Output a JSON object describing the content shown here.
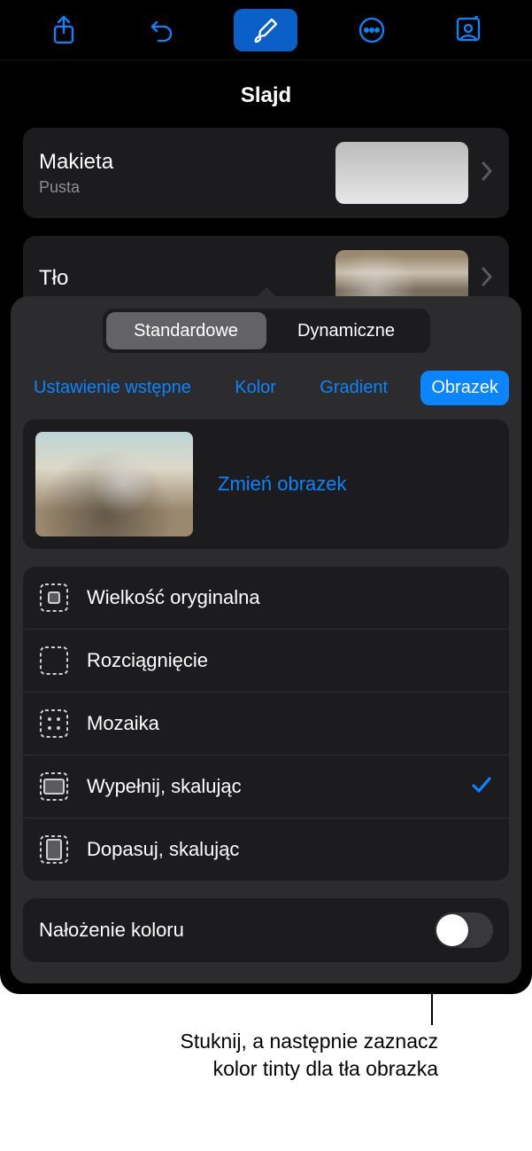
{
  "toolbar": {
    "share_icon": "share-icon",
    "undo_icon": "undo-icon",
    "brush_icon": "brush-icon",
    "more_icon": "more-icon",
    "present_icon": "present-icon"
  },
  "title": "Slajd",
  "layout": {
    "label": "Makieta",
    "subtitle": "Pusta"
  },
  "background": {
    "label": "Tło"
  },
  "segmented": {
    "items": [
      "Standardowe",
      "Dynamiczne"
    ],
    "selected": 0
  },
  "categories": {
    "items": [
      "Ustawienie wstępne",
      "Kolor",
      "Gradient",
      "Obrazek"
    ],
    "selected": 3
  },
  "image_panel": {
    "change_label": "Zmień obrazek"
  },
  "fill_options": {
    "items": [
      {
        "label": "Wielkość oryginalna"
      },
      {
        "label": "Rozciągnięcie"
      },
      {
        "label": "Mozaika"
      },
      {
        "label": "Wypełnij, skalując"
      },
      {
        "label": "Dopasuj, skalując"
      }
    ],
    "selected": 3
  },
  "overlay": {
    "label": "Nałożenie koloru",
    "enabled": false
  },
  "callout": "Stuknij, a następnie zaznacz kolor tinty dla tła obrazka"
}
